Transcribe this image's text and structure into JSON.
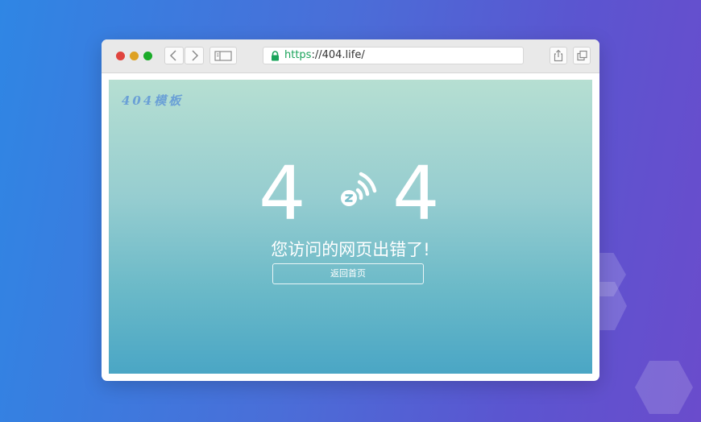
{
  "browser": {
    "url_scheme": "https",
    "url_rest": "://404.life/",
    "traffic_lights": {
      "close": "#e0443e",
      "minimize": "#dea123",
      "maximize": "#1aab29"
    },
    "icons": [
      "back-arrow-icon",
      "forward-arrow-icon",
      "sidebar-icon",
      "lock-icon",
      "share-icon",
      "tabs-icon"
    ]
  },
  "page": {
    "logo_text": "404模板",
    "digit_left": "4",
    "digit_right": "4",
    "middle_icon": "z-signal-icon",
    "message": "您访问的网页出错了!",
    "home_button_label": "返回首页"
  },
  "colors": {
    "accent_green": "#1aa35a",
    "logo_blue": "#6aa0d6"
  }
}
